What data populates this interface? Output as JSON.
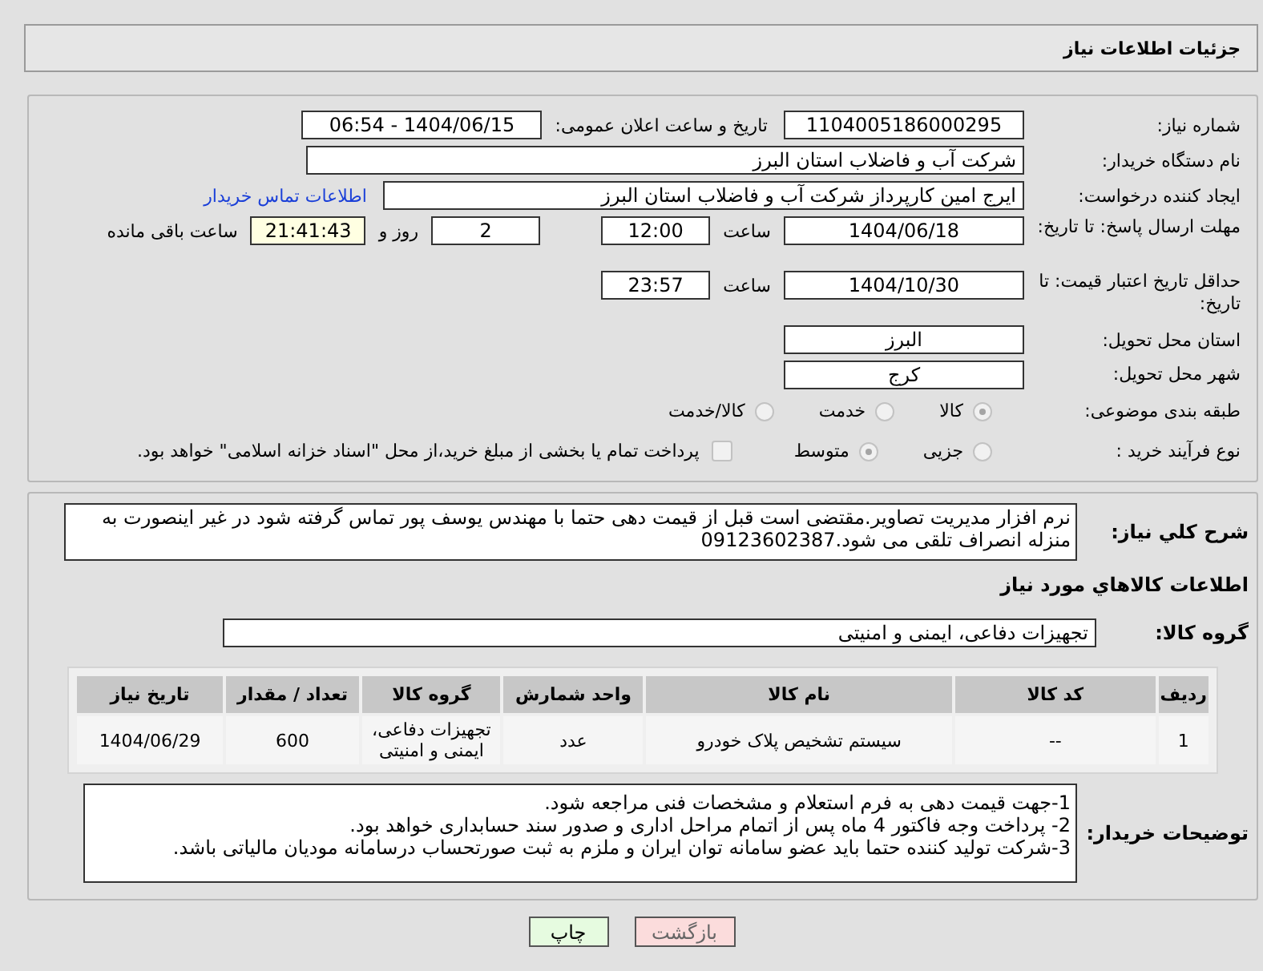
{
  "header": {
    "title": "جزئیات اطلاعات نیاز"
  },
  "details": {
    "need_number": {
      "label": "شماره نیاز:",
      "value": "1104005186000295"
    },
    "announce": {
      "label": "تاریخ و ساعت اعلان عمومی:",
      "value": "1404/06/15 - 06:54"
    },
    "buyer_org": {
      "label": "نام دستگاه خریدار:",
      "value": "شرکت آب و فاضلاب استان البرز"
    },
    "requester": {
      "label": "ایجاد کننده درخواست:",
      "value": "ایرج امین کارپرداز شرکت آب و فاضلاب استان البرز",
      "link": "اطلاعات تماس خریدار"
    },
    "deadline": {
      "label": "مهلت ارسال پاسخ: تا تاریخ:",
      "date": "1404/06/18",
      "time_label": "ساعت",
      "time": "12:00",
      "days": "2",
      "days_label": "روز و",
      "remaining": "21:41:43",
      "remaining_label": "ساعت باقی مانده"
    },
    "validity": {
      "label": "حداقل تاریخ اعتبار قیمت: تا تاریخ:",
      "date": "1404/10/30",
      "time_label": "ساعت",
      "time": "23:57"
    },
    "province": {
      "label": "استان محل تحویل:",
      "value": "البرز"
    },
    "city": {
      "label": "شهر محل تحویل:",
      "value": "کرج"
    },
    "category": {
      "label": "طبقه بندی موضوعی:",
      "options": [
        {
          "label": "کالا",
          "selected": true
        },
        {
          "label": "خدمت",
          "selected": false
        },
        {
          "label": "کالا/خدمت",
          "selected": false
        }
      ]
    },
    "process": {
      "label": "نوع فرآیند خرید :",
      "options": [
        {
          "label": "جزیی",
          "selected": false
        },
        {
          "label": "متوسط",
          "selected": true
        }
      ],
      "treasury": {
        "checked": false,
        "text": "پرداخت تمام یا بخشی از مبلغ خرید،از محل \"اسناد خزانه اسلامی\" خواهد بود."
      }
    }
  },
  "description": {
    "label": "شرح کلي نیاز:",
    "text": "نرم افزار مدیریت تصاویر.مقتضی است قبل از قیمت دهی حتما با مهندس یوسف پور تماس گرفته شود در غیر اینصورت به منزله انصراف تلقی می شود.09123602387"
  },
  "goods": {
    "title": "اطلاعات کالاهاي مورد نیاز",
    "group": {
      "label": "گروه کالا:",
      "value": "تجهیزات دفاعی، ایمنی و امنیتی"
    },
    "table": {
      "columns": [
        "ردیف",
        "کد کالا",
        "نام کالا",
        "واحد شمارش",
        "گروه کالا",
        "تعداد / مقدار",
        "تاریخ نیاز"
      ],
      "rows": [
        [
          "1",
          "--",
          "سیستم تشخیص پلاک خودرو",
          "عدد",
          "تجهیزات دفاعی، ایمنی و امنیتی",
          "600",
          "1404/06/29"
        ]
      ]
    }
  },
  "buyer_notes": {
    "label": "توضیحات خریدار:",
    "lines": [
      "1-جهت قیمت دهی به فرم استعلام و مشخصات فنی مراجعه شود.",
      "2- پرداخت وجه فاکتور 4 ماه پس از اتمام مراحل اداری و صدور سند حسابداری خواهد بود.",
      "3-شرکت تولید کننده حتما باید عضو سامانه توان ایران و ملزم به ثبت صورتحساب درسامانه مودیان مالیاتی باشد."
    ]
  },
  "buttons": [
    {
      "label": "بازگشت",
      "kind": "back"
    },
    {
      "label": "چاپ",
      "kind": "print"
    }
  ]
}
